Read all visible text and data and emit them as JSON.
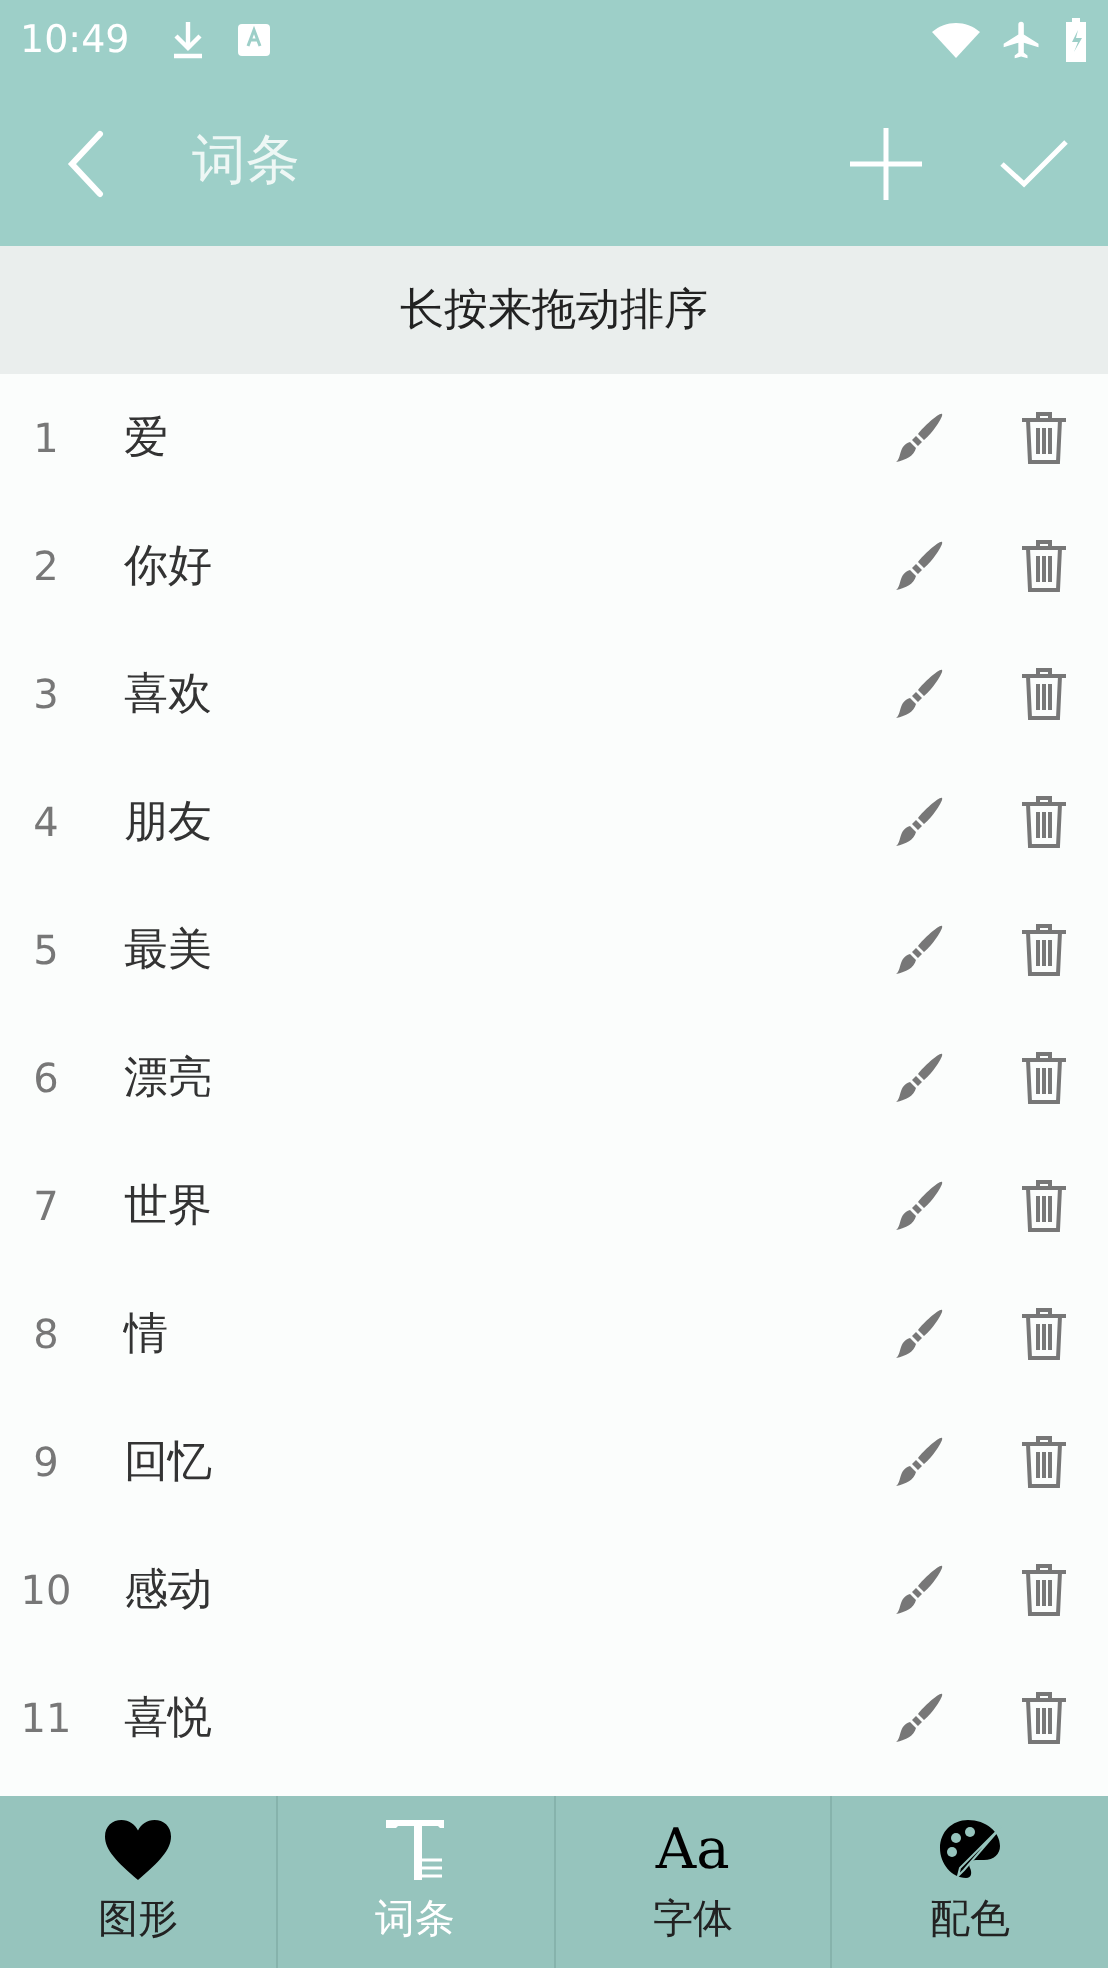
{
  "status_bar": {
    "time": "10:49"
  },
  "app_bar": {
    "title": "词条"
  },
  "hint": "长按来拖动排序",
  "entries": [
    {
      "index": "1",
      "text": "爱"
    },
    {
      "index": "2",
      "text": "你好"
    },
    {
      "index": "3",
      "text": "喜欢"
    },
    {
      "index": "4",
      "text": "朋友"
    },
    {
      "index": "5",
      "text": "最美"
    },
    {
      "index": "6",
      "text": "漂亮"
    },
    {
      "index": "7",
      "text": "世界"
    },
    {
      "index": "8",
      "text": "情"
    },
    {
      "index": "9",
      "text": "回忆"
    },
    {
      "index": "10",
      "text": "感动"
    },
    {
      "index": "11",
      "text": "喜悦"
    }
  ],
  "tabs": [
    {
      "label": "图形",
      "kind": "heart",
      "selected": false
    },
    {
      "label": "词条",
      "kind": "text",
      "selected": true
    },
    {
      "label": "字体",
      "kind": "font",
      "glyph": "Aa",
      "selected": false
    },
    {
      "label": "配色",
      "kind": "palette",
      "selected": false
    }
  ]
}
